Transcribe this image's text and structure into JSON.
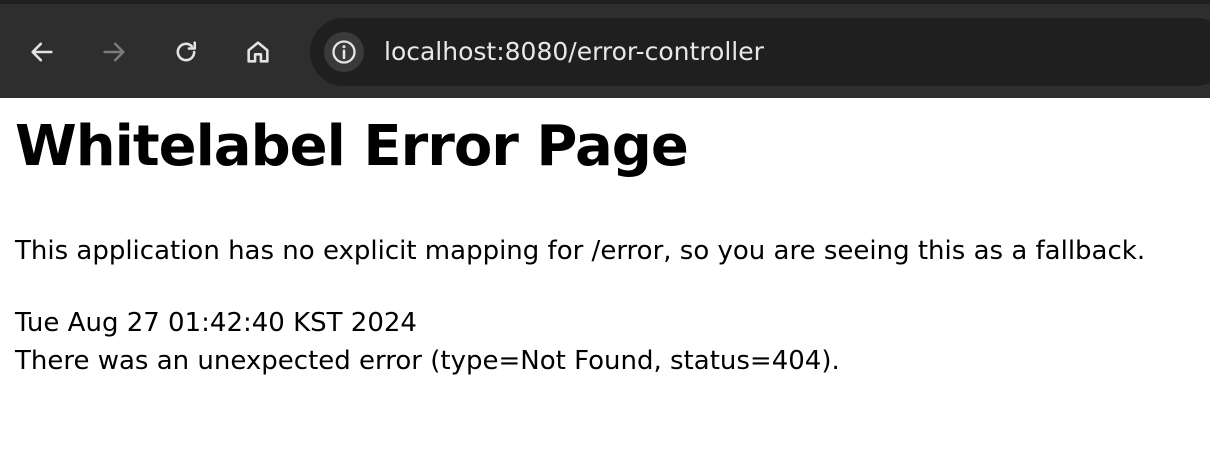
{
  "browser": {
    "url": "localhost:8080/error-controller",
    "icons": {
      "back": "arrow-left-icon",
      "forward": "arrow-right-icon",
      "reload": "reload-icon",
      "home": "home-icon",
      "site_info": "info-icon"
    },
    "forward_enabled": false
  },
  "page": {
    "title": "Whitelabel Error Page",
    "explanation": "This application has no explicit mapping for /error, so you are seeing this as a fallback.",
    "timestamp": "Tue Aug 27 01:42:40 KST 2024",
    "error_detail": "There was an unexpected error (type=Not Found, status=404)."
  },
  "colors": {
    "toolbar_bg": "#2e2e2e",
    "address_bar_bg": "#1f1f1f",
    "icon_active": "#e3e3e3",
    "icon_disabled": "#7a7a7a",
    "page_bg": "#ffffff",
    "text": "#000000"
  }
}
